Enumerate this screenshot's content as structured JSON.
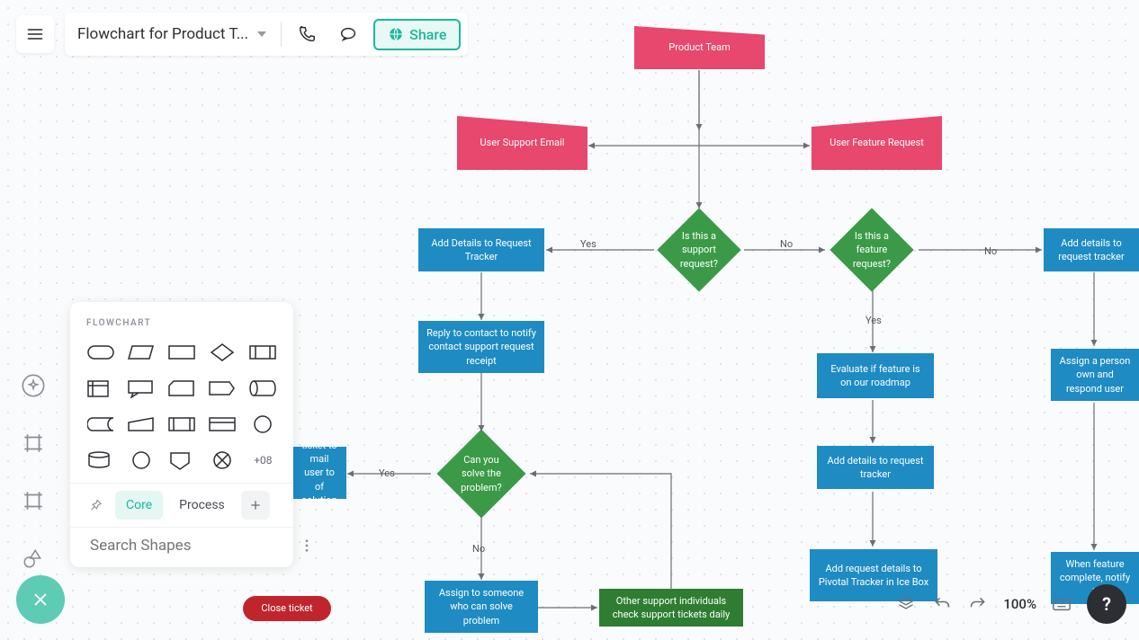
{
  "header": {
    "title": "Flowchart for Product T...",
    "share_label": "Share"
  },
  "shapes_panel": {
    "heading": "FLOWCHART",
    "more_label": "+08",
    "tabs": {
      "core": "Core",
      "process": "Process"
    },
    "search_placeholder": "Search Shapes"
  },
  "bottom": {
    "zoom": "100%",
    "help": "?"
  },
  "flow": {
    "nodes": {
      "product_team": "Product Team",
      "user_support_email": "User Support Email",
      "user_feature_request": "User Feature Request",
      "support_decision": "Is this a support request?",
      "feature_decision": "Is this a feature request?",
      "add_details_tracker": "Add Details to Request Tracker",
      "add_details_tracker2": "Add details to request tracker",
      "reply_contact": "Reply to contact to notify contact support request receipt",
      "evaluate_feature": "Evaluate if feature is on our roadmap",
      "assign_person": "Assign a person own and respond user",
      "add_details_tracker3": "Add details to request tracker",
      "solve_decision": "Can you solve the problem?",
      "ticket_email": "ticket to mail user to of solution",
      "close_ticket": "Close ticket",
      "assign_someone": "Assign to someone who can solve problem",
      "other_support": "Other support individuals check support tickets daily",
      "pivotal_tracker": "Add request details to Pivotal Tracker in Ice Box",
      "feature_complete": "When feature complete, notify it"
    },
    "labels": {
      "yes": "Yes",
      "no": "No"
    }
  }
}
